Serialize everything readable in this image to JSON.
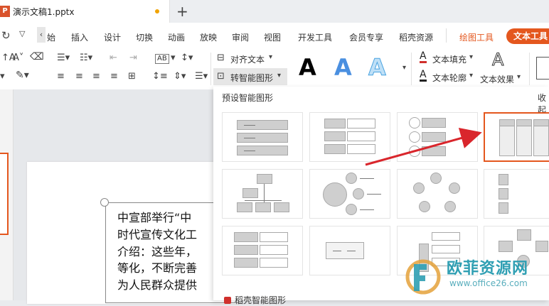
{
  "document": {
    "title": "演示文稿1.pptx",
    "app_icon": "P"
  },
  "ribbon": {
    "tabs": [
      "始",
      "插入",
      "设计",
      "切换",
      "动画",
      "放映",
      "审阅",
      "视图",
      "开发工具",
      "会员专享",
      "稻壳资源",
      "绘图工具",
      "文本工具"
    ],
    "active_accent": "#e4571e"
  },
  "toolbar": {
    "align_text": "对齐文本",
    "convert_smartart": "转智能图形",
    "text_fill": "文本填充",
    "text_outline": "文本轮廓",
    "text_effect": "文本效果",
    "style_letter": "A",
    "font_size_label": "AB"
  },
  "slide": {
    "lines": [
      "中宣部举行“中",
      "时代宣传文化工",
      "介绍：这些年，",
      "等化，不断完善",
      "为人民群众提供"
    ]
  },
  "panel": {
    "title": "预设智能图形",
    "collapse": "收起",
    "footer": "稻壳智能图形"
  },
  "watermark": {
    "name": "欧菲资源网",
    "url": "www.office26.com"
  }
}
